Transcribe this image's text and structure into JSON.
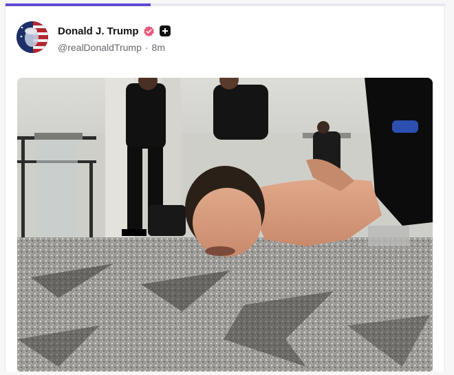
{
  "post": {
    "display_name": "Donald J. Trump",
    "handle": "@realDonaldTrump",
    "separator": "·",
    "time_ago": "8m",
    "icons": {
      "verified": "verified-badge-icon",
      "plus": "plus-subscription-icon"
    },
    "colors": {
      "verified": "#e8587a",
      "progress": "#5e4bd6"
    },
    "progress_fraction": 0.33
  }
}
